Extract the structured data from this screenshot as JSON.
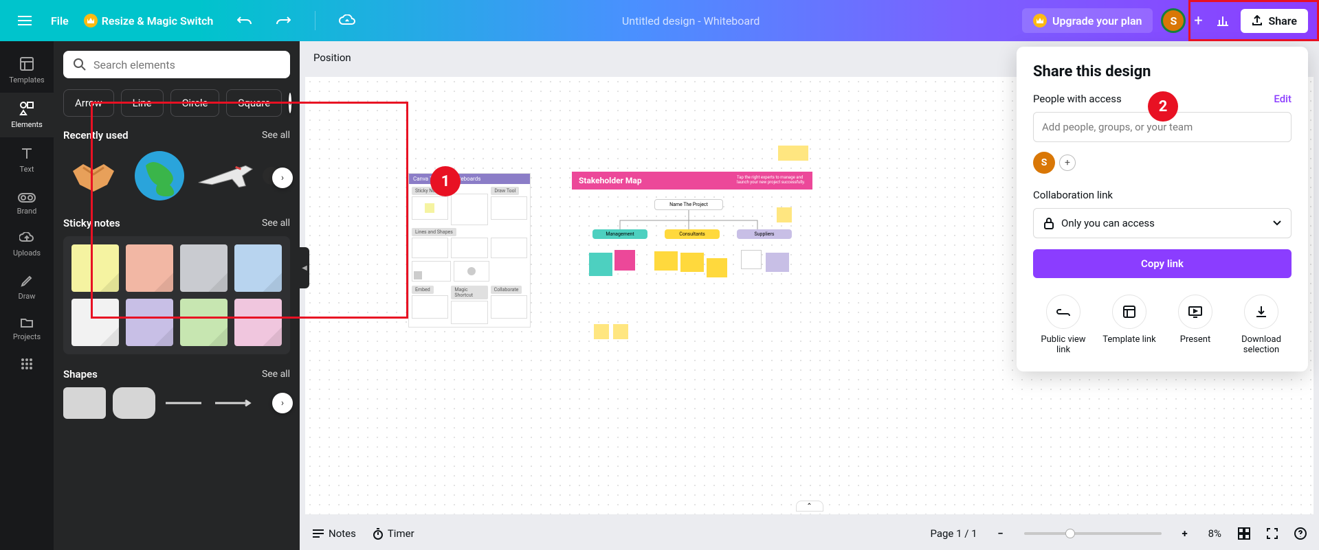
{
  "header": {
    "file_label": "File",
    "resize_label": "Resize & Magic Switch",
    "doc_title": "Untitled design - Whiteboard",
    "upgrade_label": "Upgrade your plan",
    "share_label": "Share",
    "avatar_initial": "S"
  },
  "rail": {
    "items": [
      "Templates",
      "Elements",
      "Text",
      "Brand",
      "Uploads",
      "Draw",
      "Projects"
    ],
    "active_index": 1
  },
  "panel": {
    "search_placeholder": "Search elements",
    "chips": [
      "Arrow",
      "Line",
      "Circle",
      "Square"
    ],
    "recent_title": "Recently used",
    "see_all": "See all",
    "sticky_title": "Sticky notes",
    "sticky_colors": [
      "#f5f3a1",
      "#f2b7a4",
      "#c9cbd0",
      "#b8d4ef",
      "#f2f2f2",
      "#c8bfe6",
      "#c7e6b1",
      "#f0c6de"
    ],
    "shapes_title": "Shapes"
  },
  "canvas": {
    "position_label": "Position",
    "tips": {
      "title": "Canva Tips for Whiteboards",
      "sections": [
        "Sticky Notes",
        "Draw Tool",
        "Lines and Shapes",
        "Embed",
        "Magic Shortcut",
        "Collaborate"
      ]
    },
    "stakeholder": {
      "title": "Stakeholder Map",
      "subtitle": "Tap the right experts to manage and launch your new project successfully.",
      "root": "Name The Project",
      "branches": [
        "Management",
        "Consultants",
        "Suppliers"
      ]
    }
  },
  "bottom": {
    "notes": "Notes",
    "timer": "Timer",
    "page": "Page 1 / 1",
    "zoom": "8%"
  },
  "share_panel": {
    "title": "Share this design",
    "people_label": "People with access",
    "edit": "Edit",
    "add_placeholder": "Add people, groups, or your team",
    "avatar_initial": "S",
    "collab_label": "Collaboration link",
    "access_selected": "Only you can access",
    "copy": "Copy link",
    "options": [
      "Public view link",
      "Template link",
      "Present",
      "Download selection"
    ]
  },
  "steps": {
    "one": "1",
    "two": "2"
  }
}
